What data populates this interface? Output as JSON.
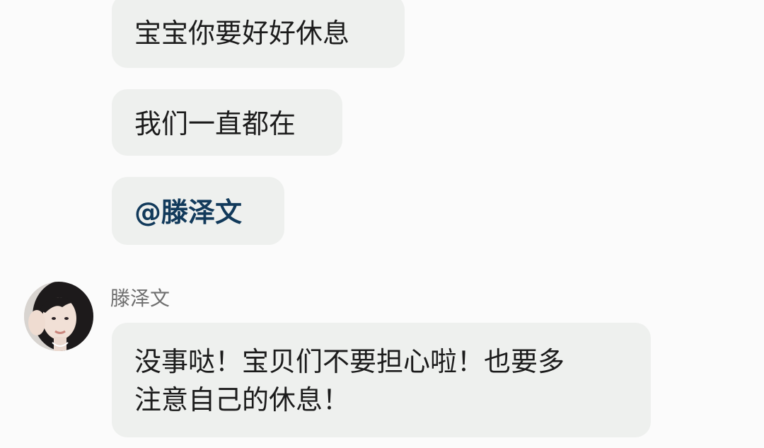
{
  "messages": [
    {
      "text": "宝宝你要好好休息"
    },
    {
      "text": "我们一直都在"
    },
    {
      "text": "@滕泽文"
    }
  ],
  "reply": {
    "sender_name": "滕泽文",
    "avatar_icon": "profile-photo",
    "line1": "没事哒！宝贝们不要担心啦！也要多",
    "line2": "注意自己的休息！"
  },
  "colors": {
    "background": "#fbfbfb",
    "bubble": "#eef0ee",
    "mention": "#123a5b",
    "name": "#6e6e6e"
  }
}
